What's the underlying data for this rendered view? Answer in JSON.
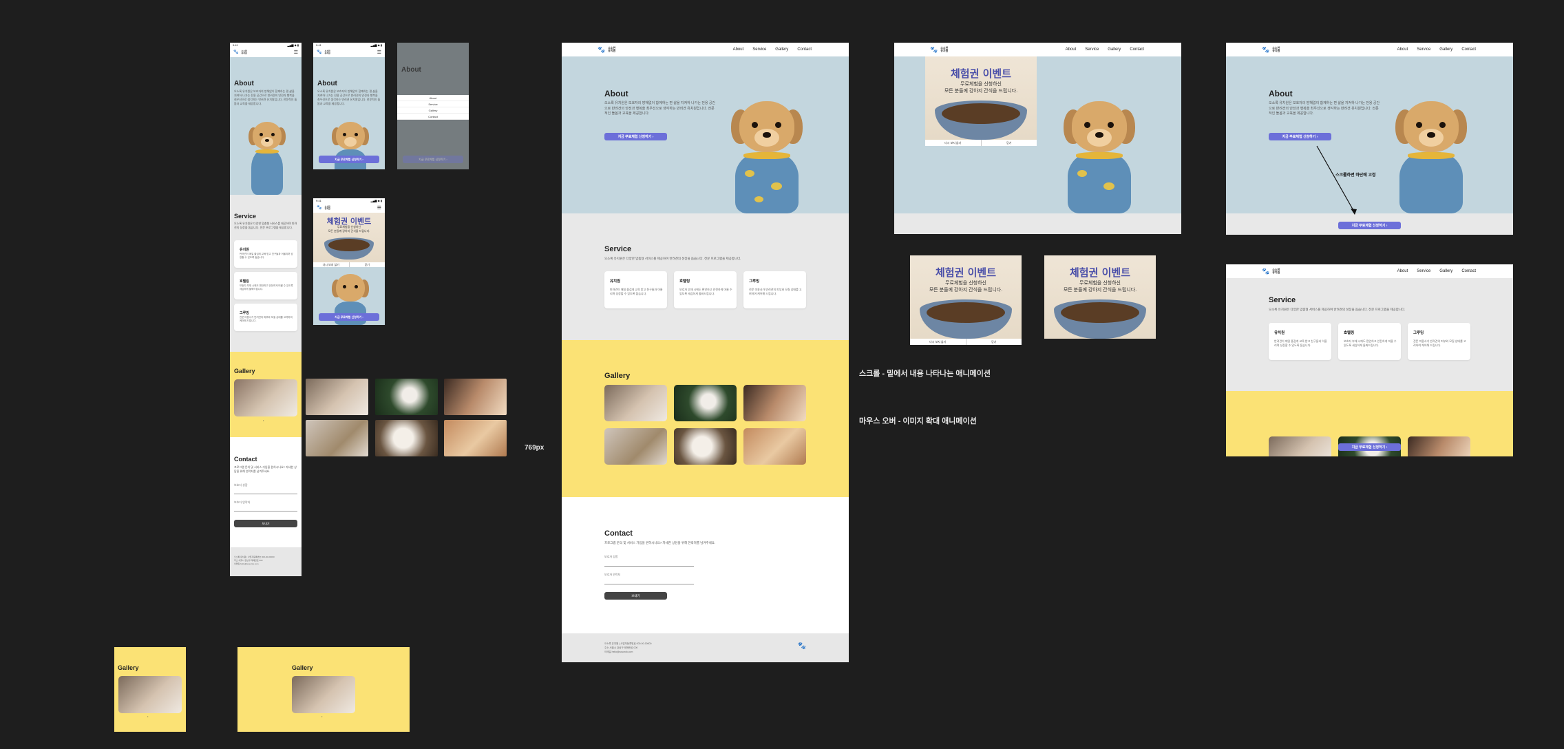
{
  "brand": {
    "line1": "소소한",
    "line2": "유치원",
    "icon": "paw-icon"
  },
  "nav": {
    "about": "About",
    "service": "Service",
    "gallery": "Gallery",
    "contact": "Contact"
  },
  "status": {
    "time": "9:41",
    "indicators": "▂▄▆ ◆ ▮"
  },
  "hero": {
    "title": "About",
    "text": "오소록 유치원은 보호자의 방해없이 함께하는 편 삶을 지켜하 나가는 전용 공간으로 반려견의 안전과 행복을 최우선으로 생각하는 반려견 유치원입니다. 전문적인 돌봄과 교육을 제공합니다.",
    "cta": "지금 무료체험 신청하기 ›"
  },
  "service": {
    "title": "Service",
    "sub": "오소록 유치원은 다양한 맞춤형 서비스를 제공하며 반려견의 성장을 돕습니다. 전문 프로그램을 제공합니다.",
    "cards": [
      {
        "title": "유치원",
        "desc": "반려견이 매일 즐겁게 교육 받고 친구들과 어울리며 성장할 수 있도록 돕습니다."
      },
      {
        "title": "호텔링",
        "desc": "보호자 부재 시에도 편안하고 안전하게 머물 수 있도록 세심하게 돌봐드립니다."
      },
      {
        "title": "그루밍",
        "desc": "전문 미용사가 반려견의 피부와 모질 상태를 고려하여 케어해 드립니다."
      }
    ]
  },
  "gallery": {
    "title": "Gallery"
  },
  "contact": {
    "title": "Contact",
    "sub": "프로그램 문의 및 서비스 가입을 원하시나요? 자세한 상담을 위해 연락처를 남겨주세요.",
    "name_label": "보호자 성함",
    "phone_label": "보호자 연락처",
    "submit": "보내기"
  },
  "footer": {
    "line1": "오소록 유치원 | 사업자등록번호 000-00-00000",
    "line2": "주소 서울시 강남구 테헤란로 000",
    "line3": "이메일 hello@sosorok.com"
  },
  "event": {
    "title": "체험권 이벤트",
    "sub1": "무료체험을 신청하신",
    "sub2": "모든 분들께 강아지 간식을 드립니다.",
    "btn_left": "다시 보지 않기",
    "btn_right": "닫기"
  },
  "mobile_menu": [
    "About",
    "Service",
    "Gallery",
    "Contact"
  ],
  "labels": {
    "width_769": "769px",
    "scroll_anim": "스크롤 - 밑에서 내용 나타나는 애니메이션",
    "hover_anim": "마우스 오버 - 이미지 확대 애니메이션",
    "fixed_note": "스크롤하면 하단에 고정"
  },
  "colors": {
    "canvas": "#1e1e1e",
    "hero": "#c3d6de",
    "service": "#e8e8e8",
    "gallery": "#fbe275",
    "accent": "#6c6fd9"
  }
}
